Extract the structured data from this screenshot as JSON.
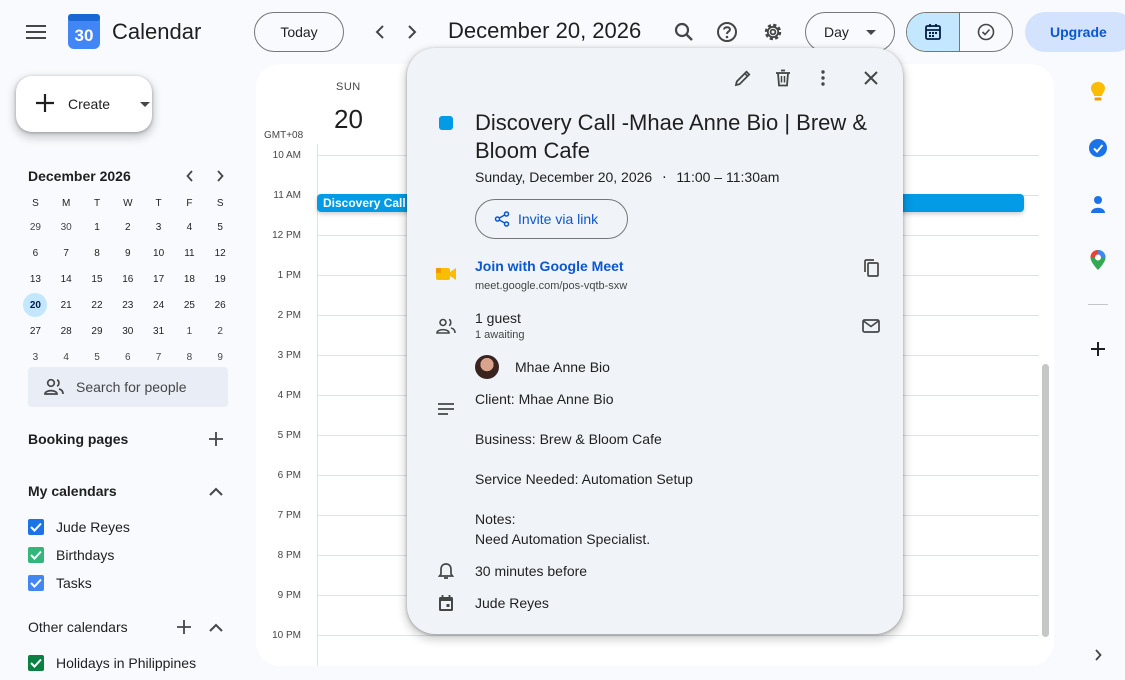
{
  "header": {
    "app_logo_day": "30",
    "app_name": "Calendar",
    "today_label": "Today",
    "date_title": "December 20, 2026",
    "view_label": "Day",
    "upgrade_label": "Upgrade"
  },
  "sidebar": {
    "create_label": "Create",
    "mini_calendar": {
      "title": "December 2026",
      "weekdays": [
        "S",
        "M",
        "T",
        "W",
        "T",
        "F",
        "S"
      ],
      "weeks": [
        [
          "29",
          "30",
          "1",
          "2",
          "3",
          "4",
          "5"
        ],
        [
          "6",
          "7",
          "8",
          "9",
          "10",
          "11",
          "12"
        ],
        [
          "13",
          "14",
          "15",
          "16",
          "17",
          "18",
          "19"
        ],
        [
          "20",
          "21",
          "22",
          "23",
          "24",
          "25",
          "26"
        ],
        [
          "27",
          "28",
          "29",
          "30",
          "31",
          "1",
          "2"
        ],
        [
          "3",
          "4",
          "5",
          "6",
          "7",
          "8",
          "9"
        ]
      ],
      "selected_day": "20"
    },
    "search_people_placeholder": "Search for people",
    "booking_pages_label": "Booking pages",
    "my_calendars_label": "My calendars",
    "my_calendars": [
      {
        "label": "Jude Reyes",
        "color": "#1a73e8",
        "checked": true
      },
      {
        "label": "Birthdays",
        "color": "#33b679",
        "checked": true
      },
      {
        "label": "Tasks",
        "color": "#4285f4",
        "checked": true
      }
    ],
    "other_calendars_label": "Other calendars",
    "other_calendars": [
      {
        "label": "Holidays in Philippines",
        "color": "#0b8043",
        "checked": true
      }
    ]
  },
  "day_view": {
    "day_of_week": "SUN",
    "day_number": "20",
    "timezone": "GMT+08",
    "hours": [
      "10 AM",
      "11 AM",
      "12 PM",
      "1 PM",
      "2 PM",
      "3 PM",
      "4 PM",
      "5 PM",
      "6 PM",
      "7 PM",
      "8 PM",
      "9 PM",
      "10 PM"
    ],
    "event_chip_label": "Discovery Call",
    "event_color": "#039be5"
  },
  "popover": {
    "title": "Discovery Call -Mhae Anne Bio | Brew & Bloom Cafe",
    "date_text": "Sunday, December 20, 2026",
    "separator": "⋅",
    "time_text": "11:00 – 11:30am",
    "invite_label": "Invite via link",
    "meet_label": "Join with Google Meet",
    "meet_url": "meet.google.com/pos-vqtb-sxw",
    "guests_count": "1 guest",
    "guests_status": "1 awaiting",
    "guest_name": "Mhae Anne Bio",
    "description": {
      "client": "Client: Mhae Anne Bio",
      "business": "Business: Brew & Bloom Cafe",
      "service": "Service Needed: Automation Setup",
      "notes_label": "Notes:",
      "notes": "Need Automation Specialist."
    },
    "reminder": "30 minutes before",
    "organizer": "Jude Reyes"
  },
  "colors": {
    "accent": "#0b57d0",
    "event": "#039be5",
    "today_circle": "#c2e7ff"
  }
}
